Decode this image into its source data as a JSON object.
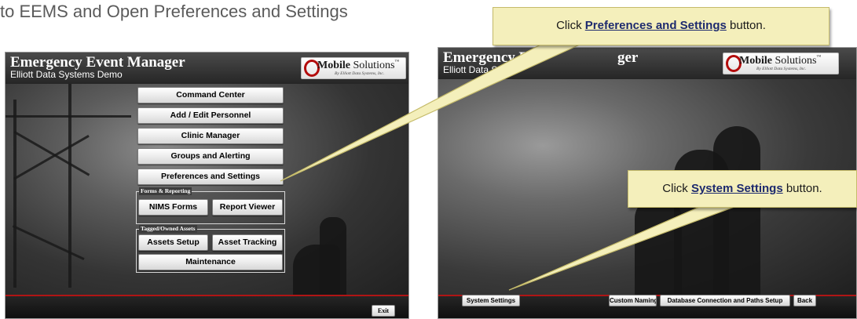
{
  "slide": {
    "title": "to EEMS and Open Preferences and Settings"
  },
  "app": {
    "title": "Emergency Event Manager",
    "subtitle": "Elliott Data Systems Demo",
    "logo": {
      "brand_bold": "Mobile",
      "brand_rest": " Solutions",
      "tm": "™",
      "byline": "By Elliott Data Systems, Inc."
    }
  },
  "left_panel": {
    "menu": [
      "Command Center",
      "Add / Edit  Personnel",
      "Clinic Manager",
      "Groups and Alerting",
      "Preferences and Settings"
    ],
    "forms_group": {
      "label": "Forms & Reporting",
      "buttons": [
        "NIMS Forms",
        "Report Viewer"
      ]
    },
    "assets_group": {
      "label": "Tagged/Owned Assets",
      "buttons": [
        "Assets Setup",
        "Asset Tracking",
        "Maintenance"
      ]
    },
    "exit_label": "Exit"
  },
  "right_panel": {
    "title_visible": "Emergency E",
    "title_tail": "ger",
    "subtitle_visible": "Elliott Data S",
    "buttons": {
      "system_settings": "System Settings",
      "custom_naming": "Custom Naming",
      "db_connection": "Database Connection and Paths Setup",
      "back": "Back"
    }
  },
  "callouts": {
    "prefs": {
      "prefix": "Click ",
      "link": "Preferences and Settings",
      "suffix": " button."
    },
    "system": {
      "prefix": "Click ",
      "link": "System Settings",
      "suffix": " button."
    }
  },
  "colors": {
    "callout_bg": "#f4efbb",
    "callout_link": "#1d2a6e",
    "accent_red": "#b01515",
    "logo_red": "#b30c0c"
  }
}
